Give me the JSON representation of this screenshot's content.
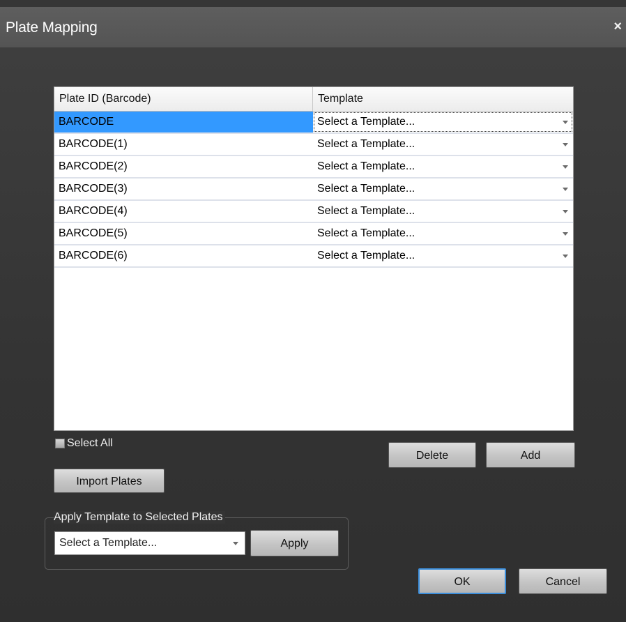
{
  "window": {
    "title": "Plate Mapping",
    "close_glyph": "×"
  },
  "grid": {
    "columns": [
      "Plate ID (Barcode)",
      "Template"
    ],
    "rows": [
      {
        "plate_id": "BARCODE",
        "template": "Select a Template...",
        "selected": true
      },
      {
        "plate_id": "BARCODE(1)",
        "template": "Select a Template..."
      },
      {
        "plate_id": "BARCODE(2)",
        "template": "Select a Template..."
      },
      {
        "plate_id": "BARCODE(3)",
        "template": "Select a Template..."
      },
      {
        "plate_id": "BARCODE(4)",
        "template": "Select a Template..."
      },
      {
        "plate_id": "BARCODE(5)",
        "template": "Select a Template..."
      },
      {
        "plate_id": "BARCODE(6)",
        "template": "Select a Template..."
      }
    ]
  },
  "controls": {
    "select_all_label": "Select All",
    "delete_label": "Delete",
    "add_label": "Add",
    "import_label": "Import Plates"
  },
  "apply_group": {
    "legend": "Apply Template to Selected Plates",
    "combo_value": "Select a Template...",
    "apply_label": "Apply"
  },
  "footer": {
    "ok_label": "OK",
    "cancel_label": "Cancel"
  },
  "colors": {
    "selection": "#3399ff",
    "dialog_bg": "#363636",
    "ok_focus": "#3c8edb"
  }
}
